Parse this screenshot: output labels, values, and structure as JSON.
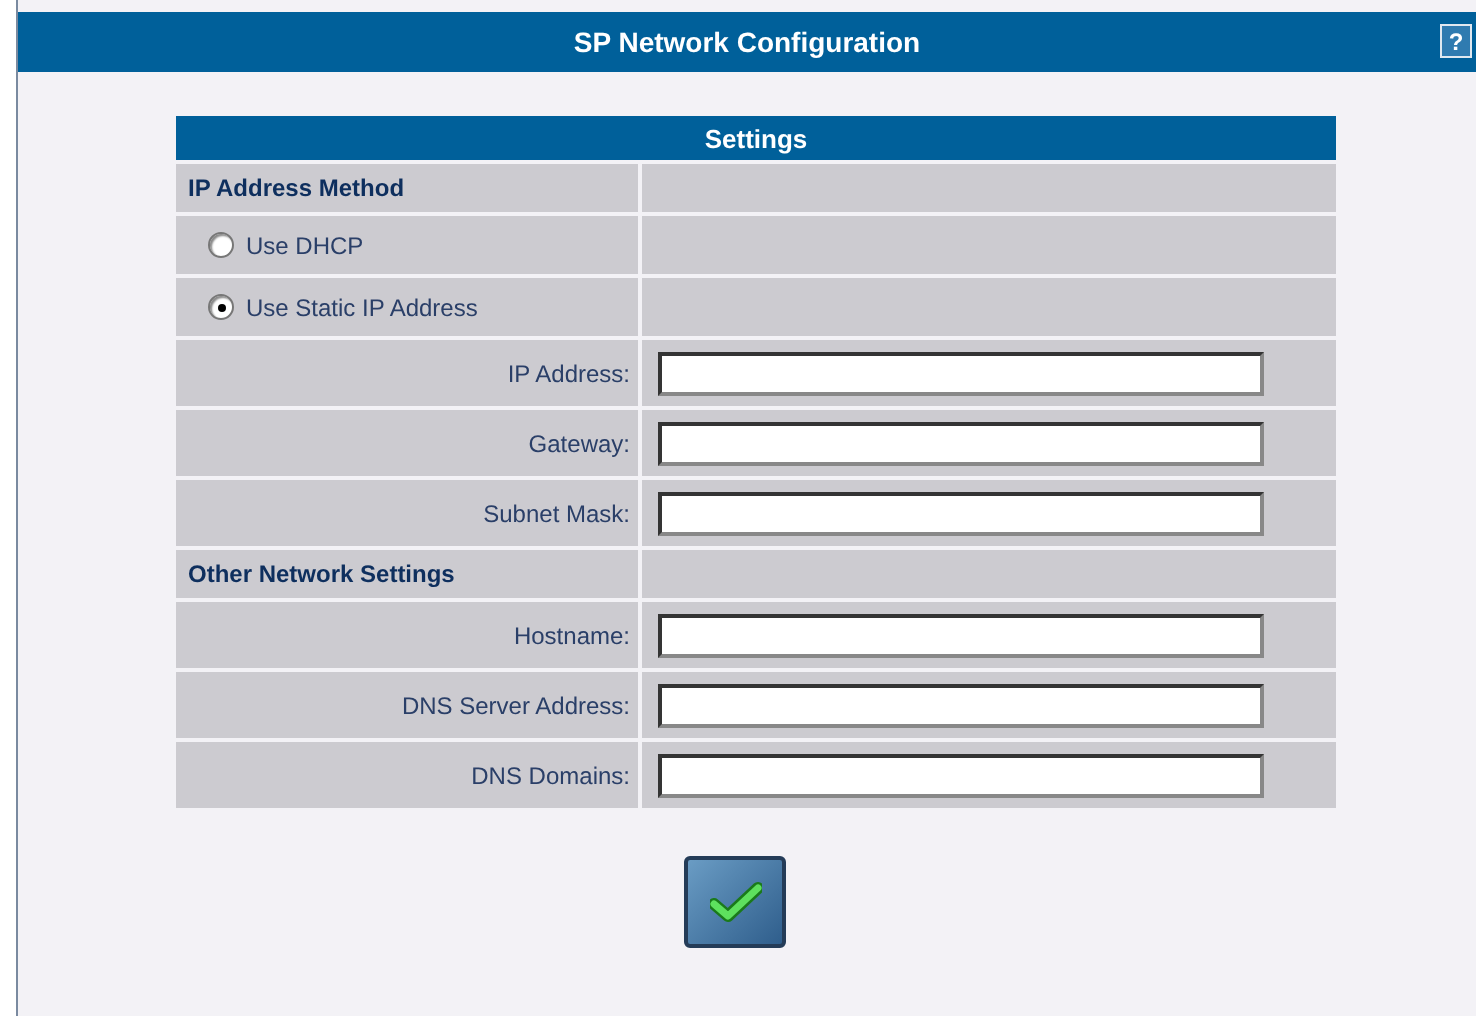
{
  "window": {
    "title": "SP Network Configuration",
    "help": "?"
  },
  "settings": {
    "title": "Settings",
    "rows": [
      {
        "kind": "section",
        "label": "IP Address Method"
      },
      {
        "kind": "radio",
        "label": "Use DHCP",
        "selected": false
      },
      {
        "kind": "radio",
        "label": "Use Static IP Address",
        "selected": true
      },
      {
        "kind": "field",
        "label": "IP Address:"
      },
      {
        "kind": "field",
        "label": "Gateway:"
      },
      {
        "kind": "field",
        "label": "Subnet Mask:"
      },
      {
        "kind": "section",
        "label": "Other Network Settings"
      },
      {
        "kind": "field",
        "label": "Hostname:"
      },
      {
        "kind": "field",
        "label": "DNS Server Address:"
      },
      {
        "kind": "field",
        "label": "DNS Domains:"
      }
    ]
  }
}
